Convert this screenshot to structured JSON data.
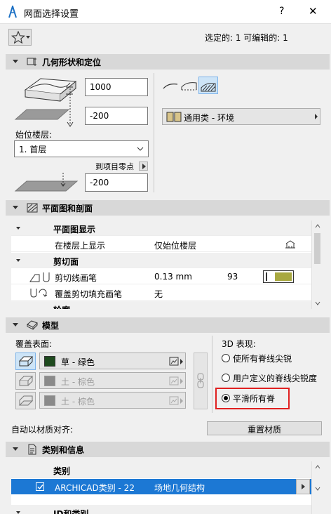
{
  "window": {
    "title": "网面选择设置",
    "help": "?",
    "close": "✕"
  },
  "status": {
    "selection": "选定的: 1 可编辑的: 1"
  },
  "geometry": {
    "header": "几何形状和定位",
    "top_value": "1000",
    "bottom_value": "-200",
    "home_story_label": "始位楼层:",
    "home_story_value": "1. 首层",
    "to_project_zero": "到项目零点",
    "offset_value": "-200",
    "building_material": "通用类 - 环境"
  },
  "plan": {
    "header": "平面图和剖面",
    "rows": [
      {
        "label": "平面图显示",
        "type": "group"
      },
      {
        "label": "在楼层上显示",
        "value": "仅始位楼层",
        "type": "item"
      },
      {
        "label": "剪切面",
        "type": "group"
      },
      {
        "label": "剪切线画笔",
        "value": "0.13 mm",
        "pen": "93",
        "type": "item"
      },
      {
        "label": "覆盖剪切填充画笔",
        "value": "无",
        "type": "item"
      },
      {
        "label": "轮廓",
        "type": "group"
      }
    ]
  },
  "model": {
    "header": "模型",
    "override_label": "覆盖表面:",
    "surfaces": [
      {
        "name": "草 - 绿色",
        "color": "#1e4a1e",
        "enabled": true
      },
      {
        "name": "土 - 棕色",
        "color": "#8a8a8a",
        "enabled": false
      },
      {
        "name": "土 - 棕色",
        "color": "#8a8a8a",
        "enabled": false
      }
    ],
    "rep_label": "3D 表现:",
    "options": [
      "使所有脊线尖锐",
      "用户定义的脊线尖锐度",
      "平滑所有脊"
    ],
    "selected_option": 2,
    "align_label": "自动以材质对齐:",
    "reset_button": "重置材质"
  },
  "classification": {
    "header": "类别和信息",
    "group_label": "类别",
    "row_name": "ARCHICAD类别 - 22",
    "row_value": "场地几何结构",
    "next_group": "ID和类别"
  },
  "colors": {
    "accent": "#1c78d4",
    "highlight": "#e02020",
    "pen_swatch": "#a8a840"
  }
}
